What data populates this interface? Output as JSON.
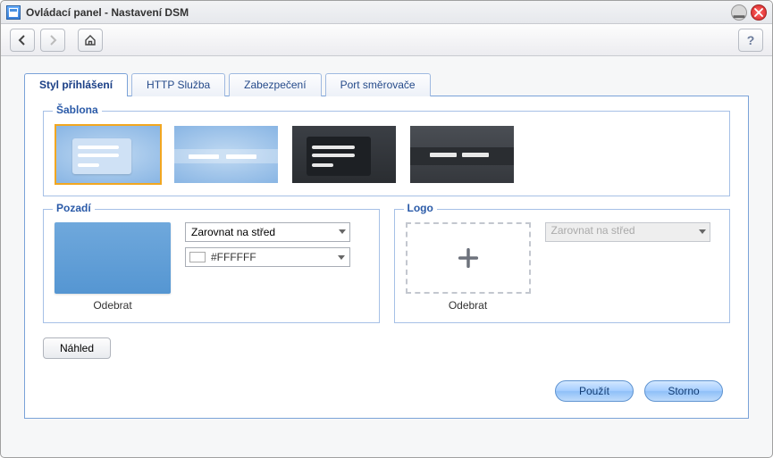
{
  "window": {
    "title": "Ovládací panel - Nastavení DSM"
  },
  "tabs": [
    {
      "label": "Styl přihlášení"
    },
    {
      "label": "HTTP Služba"
    },
    {
      "label": "Zabezpečení"
    },
    {
      "label": "Port směrovače"
    }
  ],
  "template_section": {
    "legend": "Šablona"
  },
  "background_section": {
    "legend": "Pozadí",
    "align_value": "Zarovnat na střed",
    "color_value": "#FFFFFF",
    "remove_label": "Odebrat"
  },
  "logo_section": {
    "legend": "Logo",
    "align_value": "Zarovnat na střed",
    "remove_label": "Odebrat"
  },
  "buttons": {
    "preview": "Náhled",
    "apply": "Použít",
    "cancel": "Storno"
  },
  "tooltip": {
    "help": "?"
  }
}
